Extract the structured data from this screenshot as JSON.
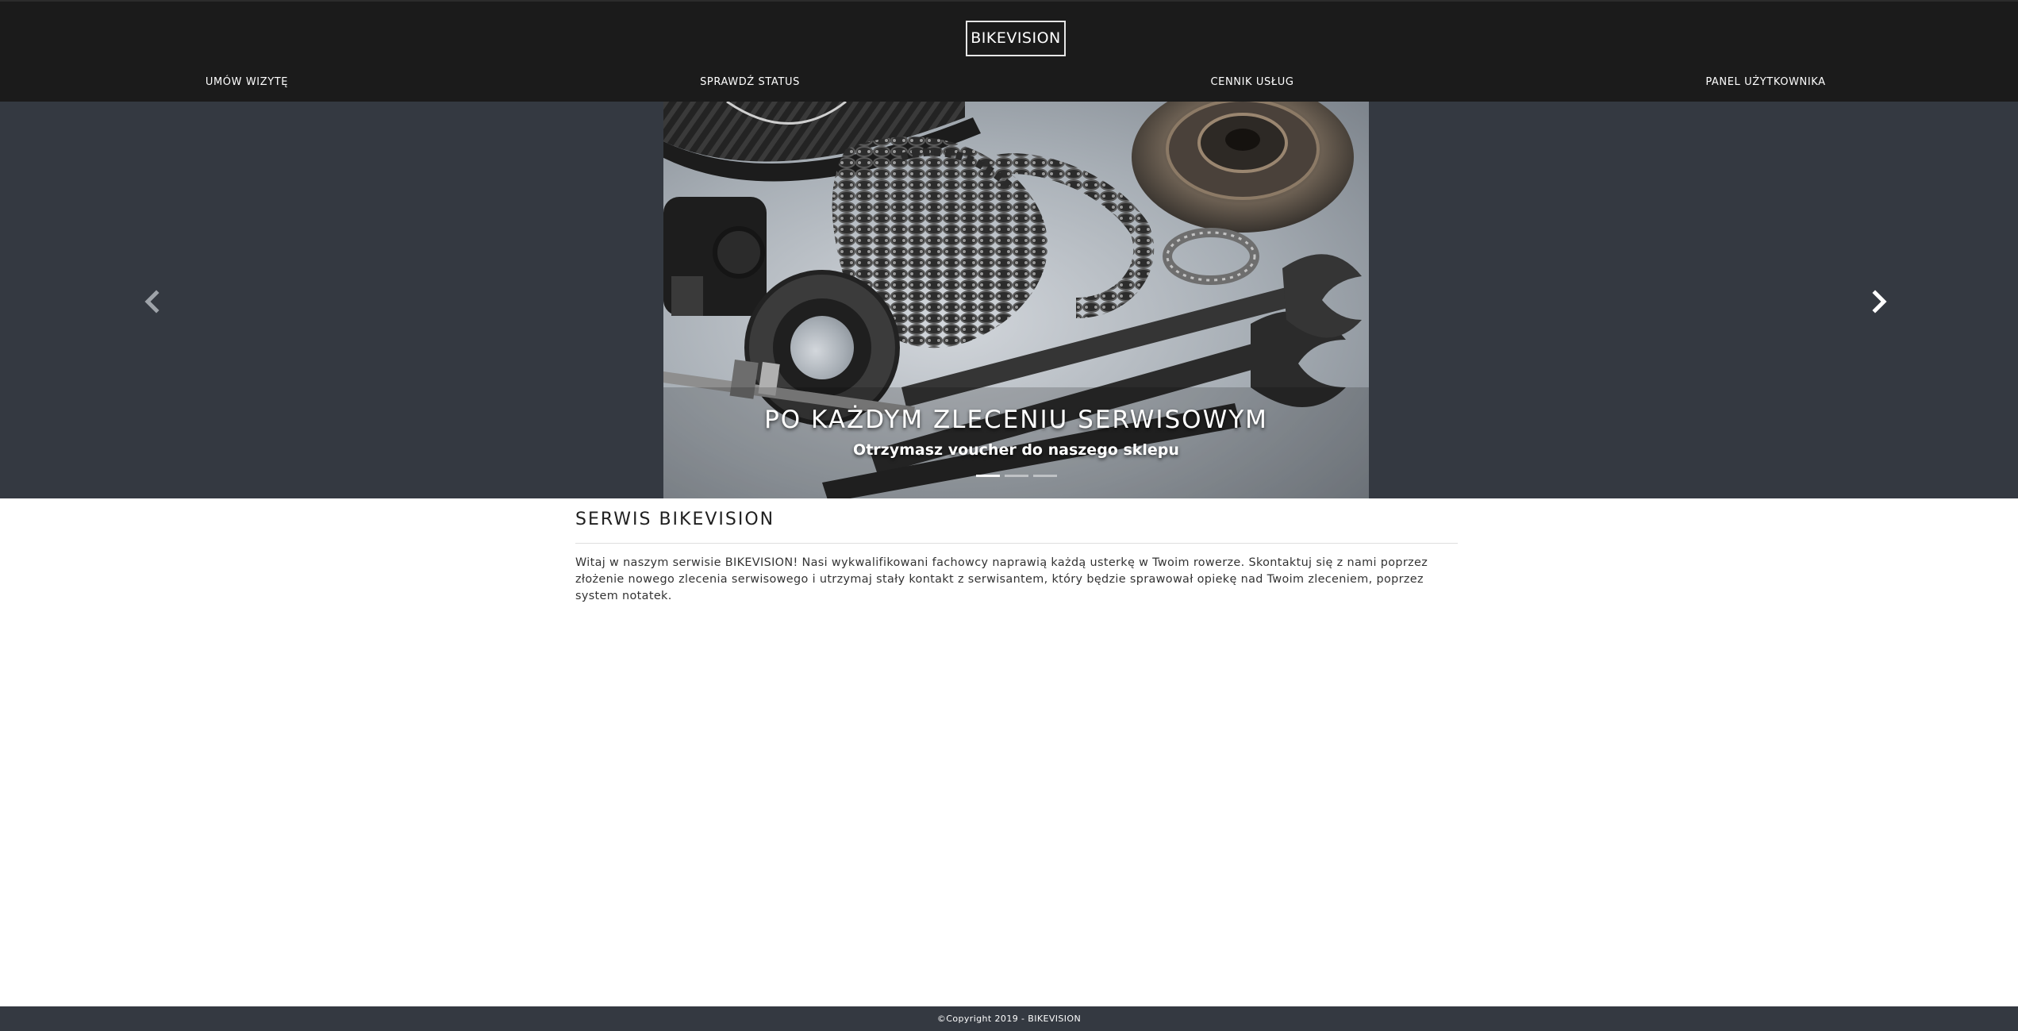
{
  "header": {
    "brand": "BIKEVISION",
    "nav": [
      {
        "label": "UMÓW WIZYTĘ"
      },
      {
        "label": "SPRAWDŹ STATUS"
      },
      {
        "label": "CENNIK USŁUG"
      },
      {
        "label": "PANEL UŻYTKOWNIKA"
      }
    ]
  },
  "carousel": {
    "caption_title": "PO KAŻDYM ZLECENIU SERWISOWYM",
    "caption_subtitle": "Otrzymasz voucher do naszego sklepu",
    "slide_count": 3,
    "active_slide": 1,
    "prev_icon": "chevron-left-icon",
    "next_icon": "chevron-right-icon"
  },
  "main": {
    "title": "SERWIS BIKEVISION",
    "paragraph": "Witaj w naszym serwisie BIKEVISION! Nasi wykwalifikowani fachowcy naprawią każdą usterkę w Twoim rowerze. Skontaktuj się z nami poprzez złożenie nowego zlecenia serwisowego i utrzymaj stały kontakt z serwisantem, który będzie sprawował opiekę nad Twoim zleceniem, poprzez system notatek."
  },
  "footer": {
    "copyright": "©Copyright 2019 - BIKEVISION"
  },
  "colors": {
    "header_bg": "#1b1b1b",
    "carousel_bg": "#343941",
    "footer_bg": "#343941",
    "text_dark": "#1f1f1f"
  }
}
